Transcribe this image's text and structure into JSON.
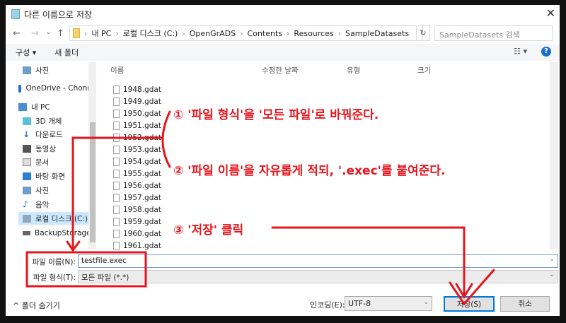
{
  "window": {
    "title": "다른 이름으로 저장",
    "close": "✕"
  },
  "nav": {
    "back": "←",
    "forward": "→",
    "recent": "⌄",
    "up": "↑",
    "path": [
      "내 PC",
      "로컬 디스크 (C:)",
      "OpenGrADS",
      "Contents",
      "Resources",
      "SampleDatasets"
    ],
    "refresh": "↻",
    "search_placeholder": "SampleDatasets 검색"
  },
  "toolbar": {
    "organize": "구성 ▾",
    "new_folder": "새 폴더",
    "view": "☷ ▾",
    "help": "?"
  },
  "sidebar": {
    "items": [
      {
        "label": "사진",
        "pin": "📌"
      },
      {
        "label": "OneDrive - Chonn"
      },
      {
        "label": "내 PC"
      },
      {
        "label": "3D 개체"
      },
      {
        "label": "다운로드"
      },
      {
        "label": "동영상"
      },
      {
        "label": "문서"
      },
      {
        "label": "바탕 화면"
      },
      {
        "label": "사진"
      },
      {
        "label": "음악"
      },
      {
        "label": "로컬 디스크 (C:)"
      },
      {
        "label": "BackupStorage ("
      }
    ]
  },
  "columns": [
    "이름",
    "수정한 날짜",
    "유형",
    "크기"
  ],
  "files": [
    "1948.gdat",
    "1949.gdat",
    "1950.gdat",
    "1951.gdat",
    "1952.gdat",
    "1953.gdat",
    "1954.gdat",
    "1955.gdat",
    "1956.gdat",
    "1957.gdat",
    "1958.gdat",
    "1959.gdat",
    "1960.gdat",
    "1961.gdat"
  ],
  "form": {
    "filename_label": "파일 이름(N):",
    "filename_value": "testfile.exec",
    "filetype_label": "파일 형식(T):",
    "filetype_value": "모든 파일 (*.*)"
  },
  "bottom": {
    "hide_folders": "^ 폴더 숨기기",
    "encoding_label": "인코딩(E):",
    "encoding_value": "UTF-8",
    "save": "저장(S)",
    "cancel": "취소"
  },
  "annotations": {
    "step1": "① '파일 형식'을 '모든 파일'로 바꿔준다.",
    "step2": "② '파일 이름'을 자유롭게 적되, '.exec'를 붙여준다.",
    "step3": "③ '저장' 클릭"
  },
  "colors": {
    "annotation": "#e8141c",
    "selection": "#cce8ff"
  }
}
